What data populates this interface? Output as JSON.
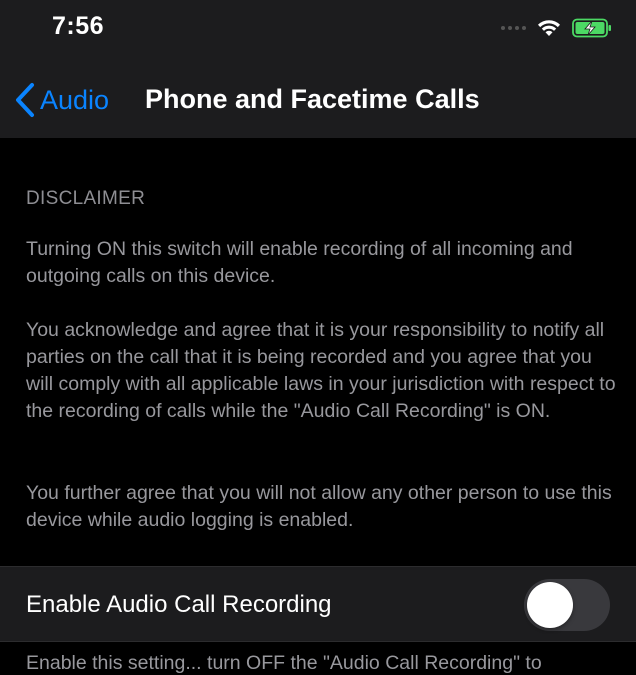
{
  "status_bar": {
    "time": "7:56",
    "wifi_icon": "wifi-icon",
    "battery_icon": "battery-charging-icon",
    "battery_color": "#4cd964"
  },
  "nav": {
    "back_label": "Audio",
    "title": "Phone and Facetime Calls",
    "accent_color": "#0a84ff"
  },
  "disclaimer": {
    "heading": "DISCLAIMER",
    "paragraph_1": "Turning ON this switch will enable recording of all incoming and outgoing calls on this device.",
    "paragraph_2": "You acknowledge and agree that it is your responsibility to notify all parties on the call that it is being recorded and you agree that you will comply with all applicable laws in your jurisdiction with respect to the recording of calls while the \"Audio Call Recording\" is ON.",
    "paragraph_3": "You further agree that you will not allow any other person to use this device while audio logging is enabled."
  },
  "setting": {
    "label": "Enable Audio Call Recording",
    "enabled": false
  },
  "footer": {
    "partial_text": "Enable this setting... turn OFF the \"Audio Call Recording\" to"
  }
}
